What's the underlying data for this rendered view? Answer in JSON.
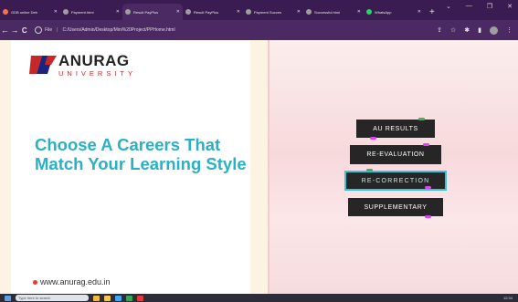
{
  "browser": {
    "tabs": [
      {
        "label": "GDB online Deb",
        "color": "#ff7043",
        "active": false
      },
      {
        "label": "Payment.html",
        "color": "#9e9e9e",
        "active": false
      },
      {
        "label": "Result PayPlus",
        "color": "#9e9e9e",
        "active": true
      },
      {
        "label": "Result PayPlus",
        "color": "#9e9e9e",
        "active": false
      },
      {
        "label": "Payment Succes",
        "color": "#9e9e9e",
        "active": false
      },
      {
        "label": "Successful.html",
        "color": "#9e9e9e",
        "active": false
      },
      {
        "label": "WhatsApp",
        "color": "#25d366",
        "active": false
      }
    ],
    "new_tab": "+",
    "window_controls": [
      "⌄",
      "—",
      "❐",
      "✕"
    ],
    "address": {
      "scheme": "File",
      "url": "C:/Users/Admin/Desktop/Mini%20Project/PPHome.html"
    },
    "nav": {
      "back": "←",
      "forward": "→",
      "reload": "C"
    }
  },
  "page": {
    "logo": {
      "name": "ANURAG",
      "subtitle": "UNIVERSITY"
    },
    "headline": "Choose A Careers That Match Your Learning Style",
    "website": "www.anurag.edu.in",
    "menu": [
      {
        "label": "AU RESULTS",
        "highlighted": false
      },
      {
        "label": "RE-EVALUATION",
        "highlighted": false
      },
      {
        "label": "RE-CORRECTION",
        "highlighted": true
      },
      {
        "label": "SUPPLEMENTARY",
        "highlighted": false
      }
    ]
  },
  "taskbar": {
    "search_placeholder": "Type here to search",
    "clock": "12:34"
  },
  "colors": {
    "accent": "#2ab0c5",
    "brand_red": "#c62828",
    "button_bg": "#262626",
    "highlight_border": "#38c4d6"
  }
}
